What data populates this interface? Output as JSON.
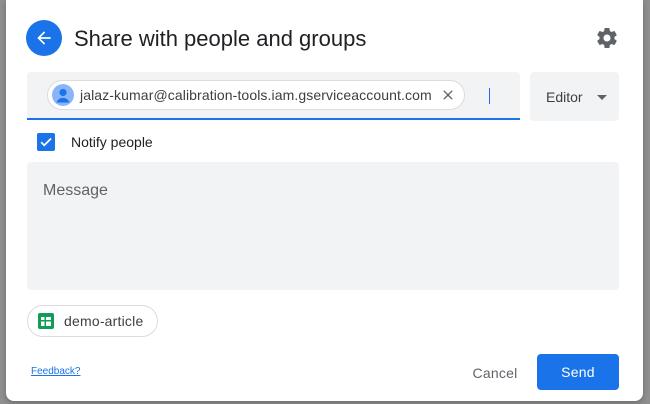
{
  "dialog": {
    "title": "Share with people and groups"
  },
  "recipients": [
    {
      "email": "jalaz-kumar@calibration-tools.iam.gserviceaccount.com"
    }
  ],
  "role": {
    "selected": "Editor"
  },
  "notify": {
    "label": "Notify people",
    "checked": true
  },
  "message": {
    "placeholder": "Message"
  },
  "file": {
    "name": "demo-article",
    "icon": "google-sheets-icon"
  },
  "footer": {
    "feedback_label": "Feedback?",
    "cancel_label": "Cancel",
    "send_label": "Send"
  },
  "colors": {
    "accent": "#1a73e8",
    "field_background": "#f1f3f4",
    "sheets_green": "#0f9d58"
  }
}
